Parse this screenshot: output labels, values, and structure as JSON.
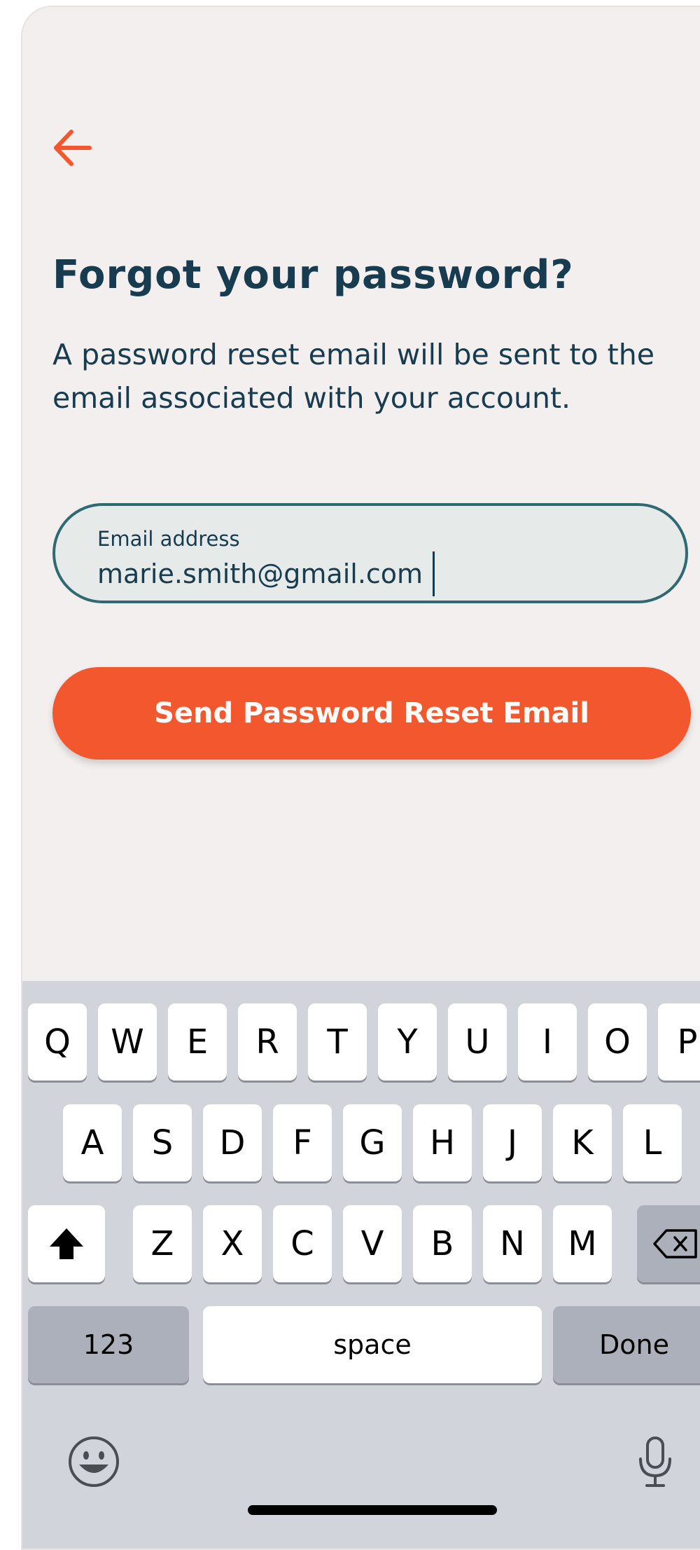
{
  "header": {
    "back_icon": "arrow-left-icon",
    "accent_color": "#f2572d"
  },
  "main": {
    "title": "Forgot your password?",
    "subtitle": "A password reset email will be sent to the email associated with your account.",
    "email_field": {
      "label": "Email address",
      "value": "marie.smith@gmail.com"
    },
    "submit_label": "Send Password Reset Email"
  },
  "keyboard": {
    "row1": [
      "Q",
      "W",
      "E",
      "R",
      "T",
      "Y",
      "U",
      "I",
      "O",
      "P"
    ],
    "row2": [
      "A",
      "S",
      "D",
      "F",
      "G",
      "H",
      "J",
      "K",
      "L"
    ],
    "row3": [
      "Z",
      "X",
      "C",
      "V",
      "B",
      "N",
      "M"
    ],
    "numbers_label": "123",
    "space_label": "space",
    "done_label": "Done",
    "shift_icon": "shift-icon",
    "backspace_icon": "backspace-icon",
    "emoji_icon": "emoji-icon",
    "mic_icon": "microphone-icon"
  }
}
